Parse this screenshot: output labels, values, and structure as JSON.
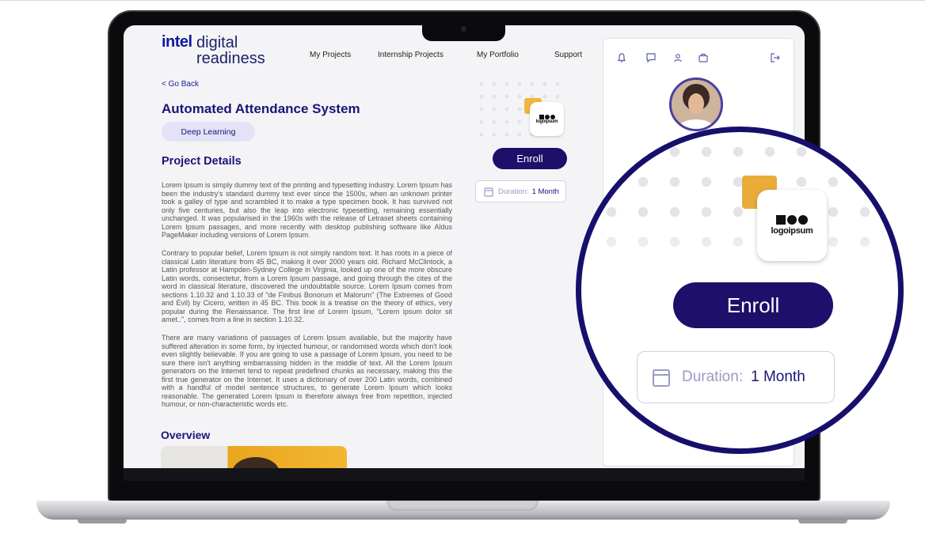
{
  "brand": {
    "intel": "intel",
    "digital": "digital",
    "readiness": "readiness"
  },
  "nav": [
    "My Projects",
    "Internship Projects",
    "My Portfolio",
    "Support"
  ],
  "go_back": "< Go Back",
  "project": {
    "title": "Automated Attendance System",
    "tag": "Deep Learning",
    "details_heading": "Project Details",
    "paragraphs": [
      "Lorem Ipsum is simply dummy text of the printing and typesetting industry. Lorem Ipsum has been the industry's standard dummy text ever since the 1500s, when an unknown printer took a galley of type and scrambled it to make a type specimen book. It has survived not only five centuries, but also the leap into electronic typesetting, remaining essentially unchanged. It was popularised in the 1960s with the release of Letraset sheets containing Lorem Ipsum passages, and more recently with desktop publishing software like Aldus PageMaker including versions of Lorem Ipsum.",
      "Contrary to popular belief, Lorem Ipsum is not simply random text. It has roots in a piece of classical Latin literature from 45 BC, making it over 2000 years old. Richard McClintock, a Latin professor at Hampden-Sydney College in Virginia, looked up one of the more obscure Latin words, consectetur, from a Lorem Ipsum passage, and going through the cites of the word in classical literature, discovered the undoubtable source. Lorem Ipsum comes from sections 1.10.32 and 1.10.33 of \"de Finibus Bonorum et Malorum\" (The Extremes of Good and Evil) by Cicero, written in 45 BC. This book is a treatise on the theory of ethics, very popular during the Renaissance. The first line of Lorem Ipsum, \"Lorem ipsum dolor sit amet..\", comes from a line in section 1.10.32.",
      "There are many variations of passages of Lorem Ipsum available, but the majority have suffered alteration in some form, by injected humour, or randomised words which don't look even slightly believable. If you are going to use a passage of Lorem Ipsum, you need to be sure there isn't anything embarrassing hidden in the middle of text. All the Lorem Ipsum generators on the Internet tend to repeat predefined chunks as necessary, making this the first true generator on the Internet. It uses a dictionary of over 200 Latin words, combined with a handful of model sentence structures, to generate Lorem Ipsum which looks reasonable. The generated Lorem Ipsum is therefore always free from repetition, injected humour, or non-characteristic words etc."
    ],
    "overview_heading": "Overview"
  },
  "company_logo_text": "logoipsum",
  "enroll_label": "Enroll",
  "duration": {
    "label": "Duration:",
    "value": "1 Month"
  },
  "panel_icons": [
    "bell-icon",
    "message-icon",
    "user-icon",
    "briefcase-icon",
    "logout-icon"
  ],
  "colors": {
    "primary": "#1e0f6b",
    "heading": "#1b1577",
    "accent": "#f0b53c",
    "tag_bg": "#e4e2f7"
  }
}
